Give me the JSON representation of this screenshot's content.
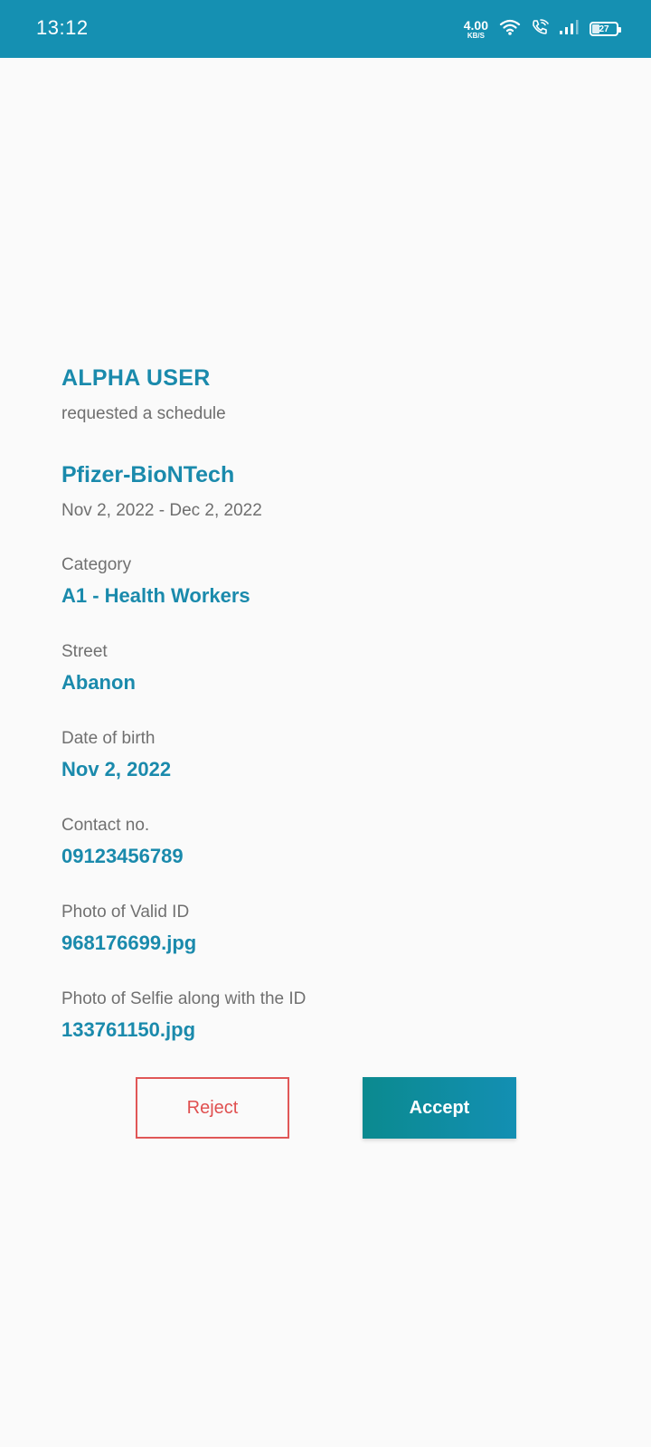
{
  "status_bar": {
    "time": "13:12",
    "net_speed_value": "4.00",
    "net_speed_unit": "KB/S",
    "battery_level": "27",
    "icons": [
      "wifi-icon",
      "wifi-calling-icon",
      "signal-icon",
      "battery-icon"
    ]
  },
  "request": {
    "user_name": "ALPHA USER",
    "action_text": "requested a schedule",
    "vaccine": "Pfizer-BioNTech",
    "date_range": "Nov 2, 2022 - Dec 2, 2022"
  },
  "fields": [
    {
      "label": "Category",
      "value": "A1 - Health Workers"
    },
    {
      "label": "Street",
      "value": "Abanon"
    },
    {
      "label": "Date of birth",
      "value": "Nov 2, 2022"
    },
    {
      "label": "Contact no.",
      "value": "09123456789"
    },
    {
      "label": "Photo of Valid ID",
      "value": "968176699.jpg"
    },
    {
      "label": "Photo of Selfie along with the ID",
      "value": "133761150.jpg"
    }
  ],
  "actions": {
    "reject_label": "Reject",
    "accept_label": "Accept"
  },
  "colors": {
    "status_bar": "#1590b2",
    "accent": "#1a8aac",
    "reject": "#e05050",
    "accept_gradient_start": "#0b8a8f",
    "accept_gradient_end": "#138fb3"
  }
}
